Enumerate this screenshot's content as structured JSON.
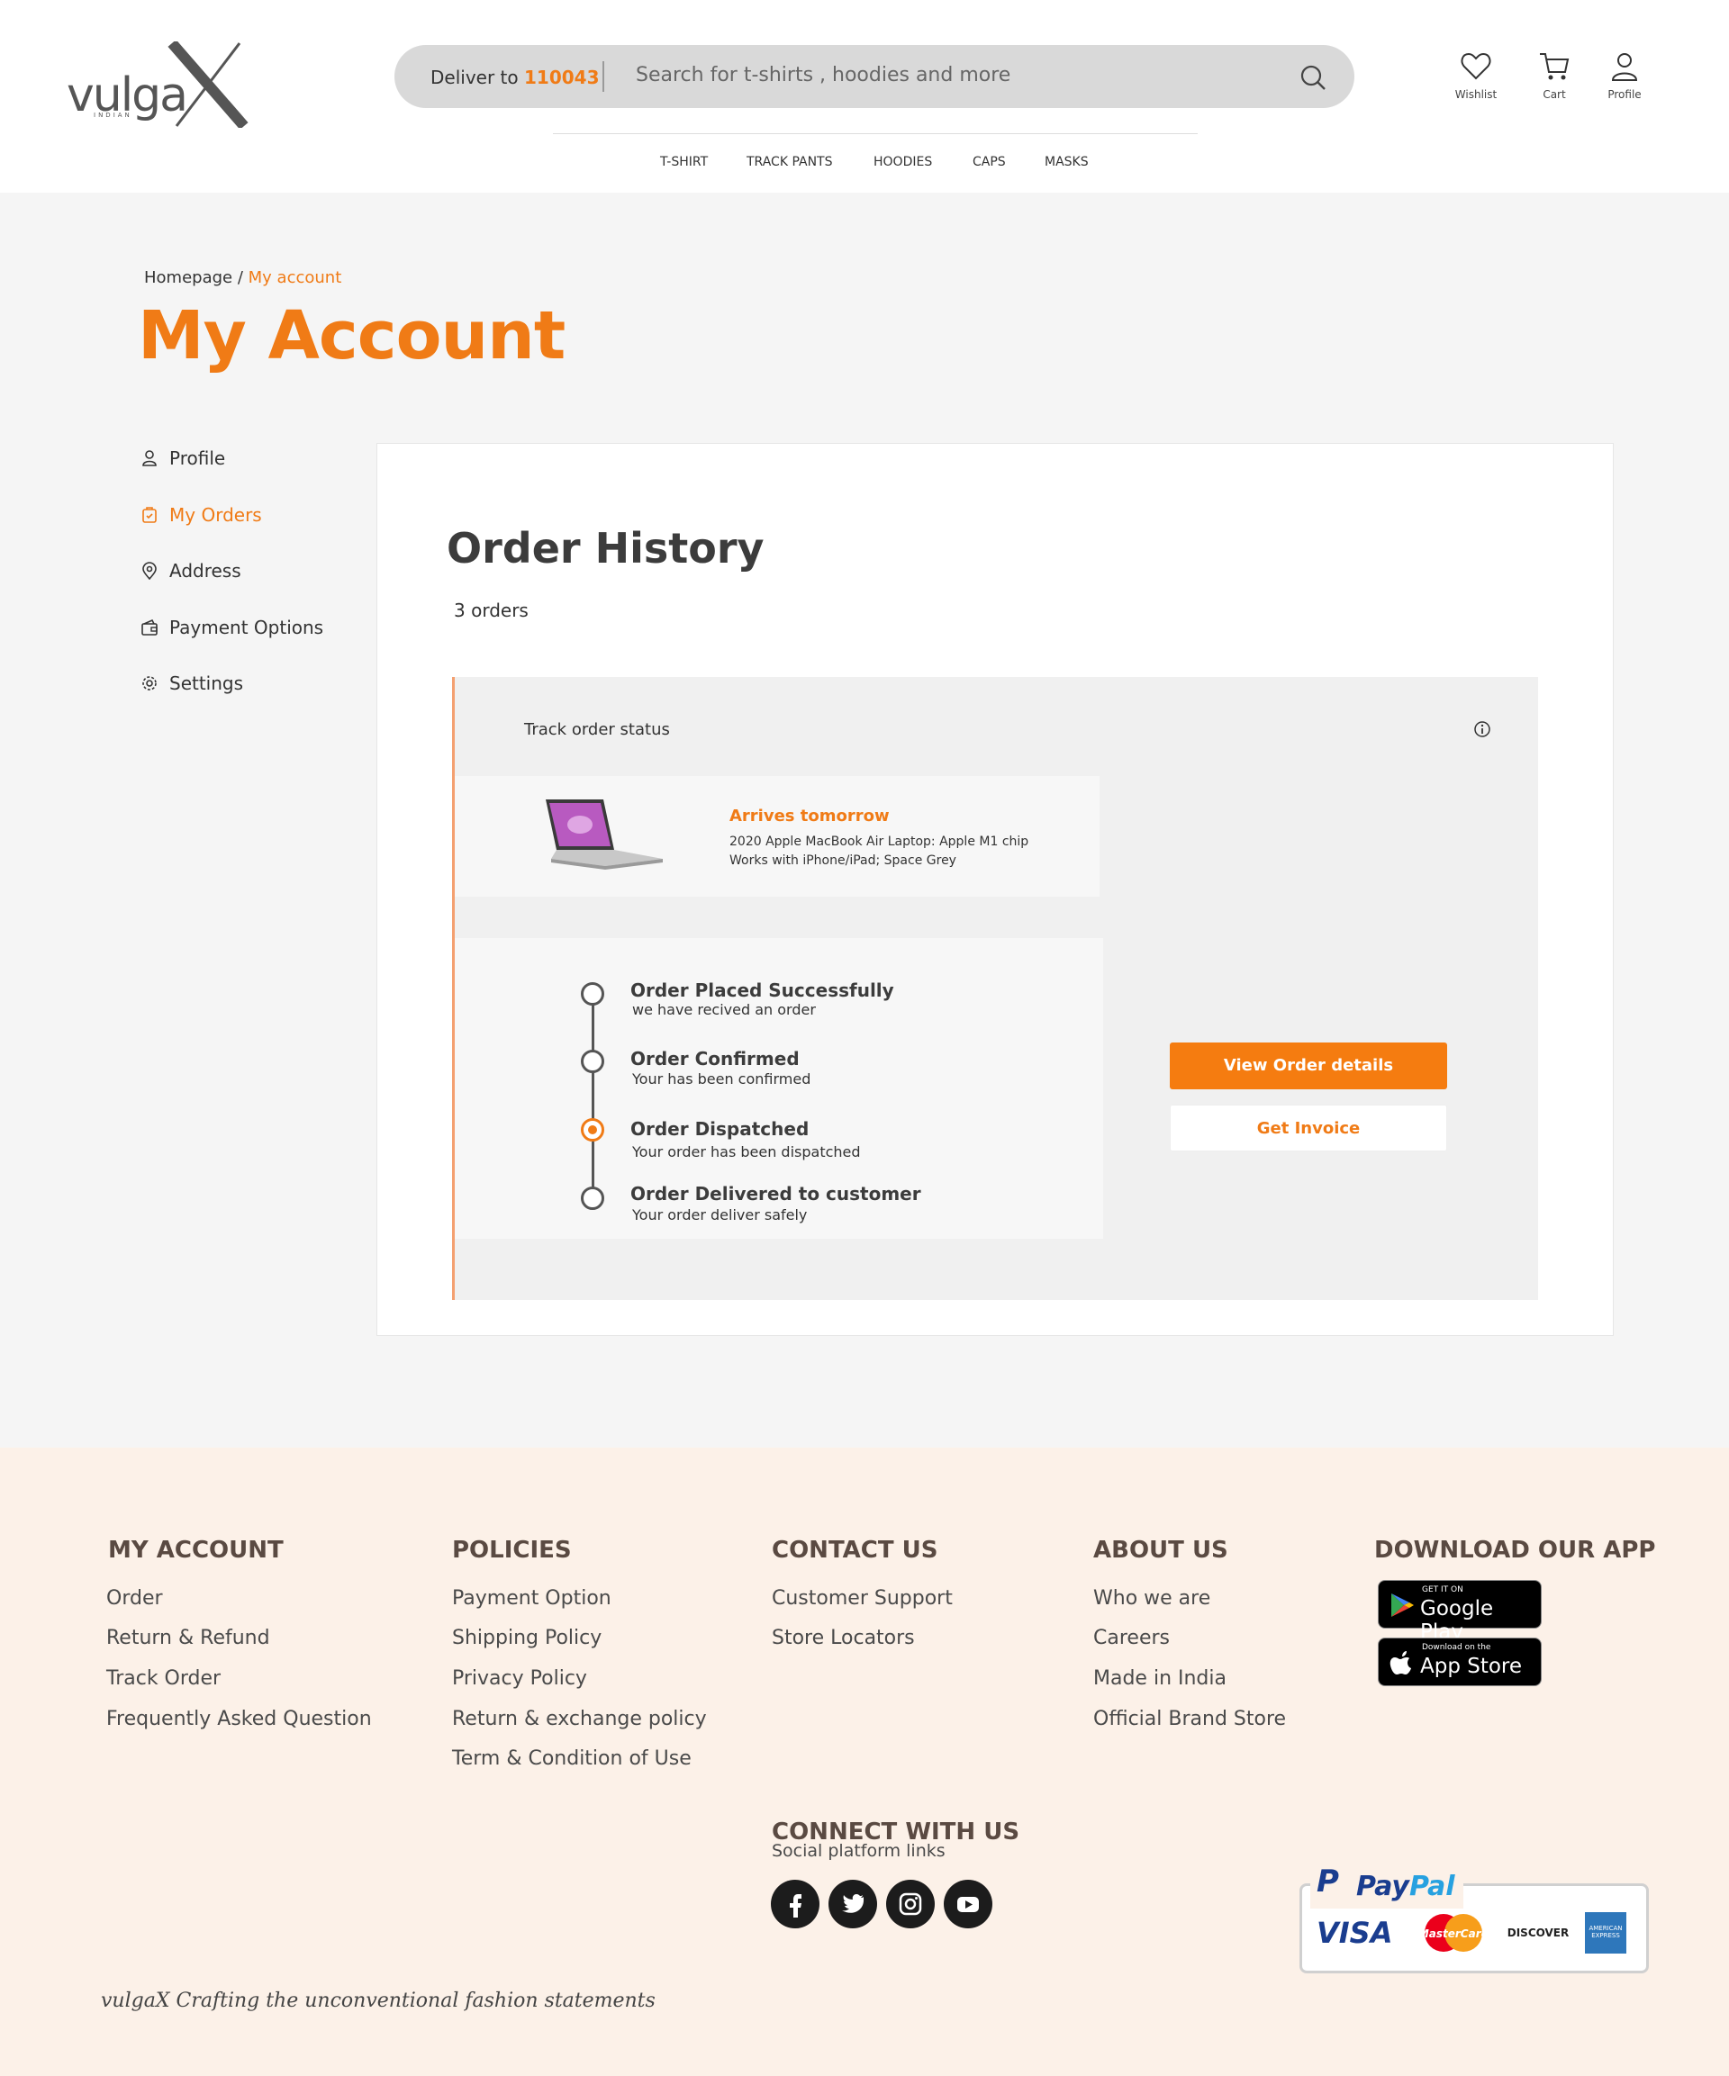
{
  "header": {
    "logo_text": "vulga",
    "logo_sub": "INDIAN",
    "deliver_prefix": "Deliver to",
    "deliver_pincode": "110043",
    "search_placeholder": "Search for t-shirts , hoodies and more",
    "wishlist_label": "Wishlist",
    "cart_label": "Cart",
    "profile_label": "Profile"
  },
  "nav": {
    "items": [
      {
        "label": "T-SHIRT"
      },
      {
        "label": "TRACK PANTS"
      },
      {
        "label": "HOODIES"
      },
      {
        "label": "CAPS"
      },
      {
        "label": "MASKS"
      }
    ]
  },
  "breadcrumb": {
    "home": "Homepage /",
    "current": "My account"
  },
  "page_title": "My Account",
  "sidebar": {
    "items": [
      {
        "label": "Profile",
        "icon": "user-icon"
      },
      {
        "label": "My Orders",
        "icon": "orders-icon"
      },
      {
        "label": "Address",
        "icon": "location-pin-icon"
      },
      {
        "label": "Payment Options",
        "icon": "wallet-icon"
      },
      {
        "label": "Settings",
        "icon": "gear-icon"
      }
    ],
    "active_index": 1
  },
  "orders": {
    "title": "Order History",
    "count_text": "3 orders",
    "track_label": "Track order status",
    "arrival": "Arrives tomorrow",
    "product_line_1": "2020 Apple MacBook Air Laptop: Apple M1 chip",
    "product_line_2": "Works with iPhone/iPad; Space Grey",
    "timeline": [
      {
        "title": "Order Placed Successfully",
        "sub": "we have recived an order",
        "active": false
      },
      {
        "title": "Order Confirmed",
        "sub": "Your has been confirmed",
        "active": false
      },
      {
        "title": "Order Dispatched",
        "sub": "Your order has been dispatched",
        "active": true
      },
      {
        "title": "Order Delivered to customer",
        "sub": "Your order deliver safely",
        "active": false
      }
    ],
    "view_button": "View Order details",
    "invoice_button": "Get Invoice"
  },
  "footer": {
    "my_account": {
      "heading": "MY ACCOUNT",
      "links": [
        "Order",
        "Return & Refund",
        "Track Order",
        "Frequently Asked Question"
      ]
    },
    "policies": {
      "heading": "POLICIES",
      "links": [
        "Payment Option",
        "Shipping Policy",
        "Privacy Policy",
        "Return & exchange policy",
        "Term & Condition of Use"
      ]
    },
    "contact": {
      "heading": "CONTACT US",
      "links": [
        "Customer Support",
        "Store Locators"
      ]
    },
    "about": {
      "heading": "ABOUT US",
      "links": [
        "Who we are",
        "Careers",
        "Made in India",
        "Official Brand Store"
      ]
    },
    "app": {
      "heading": "DOWNLOAD OUR APP",
      "google_small": "GET IT ON",
      "google_big": "Google Play",
      "apple_small": "Download on the",
      "apple_big": "App Store"
    },
    "connect": {
      "heading": "CONNECT WITH US",
      "sub": "Social platform links",
      "icons": [
        "facebook-icon",
        "twitter-icon",
        "instagram-icon",
        "youtube-icon"
      ]
    },
    "payments": {
      "paypal_p": "P",
      "paypal_pay": "Pay",
      "paypal_pal": "Pal",
      "visa": "VISA",
      "mastercard": "MasterCard",
      "discover": "DISCOVER",
      "amex": "AMERICAN EXPRESS"
    },
    "tagline": "vulgaX  Crafting the unconventional fashion statements"
  },
  "colors": {
    "accent": "#f07b16",
    "footer_bg": "#fcf1e8",
    "page_bg": "#f5f5f5"
  }
}
